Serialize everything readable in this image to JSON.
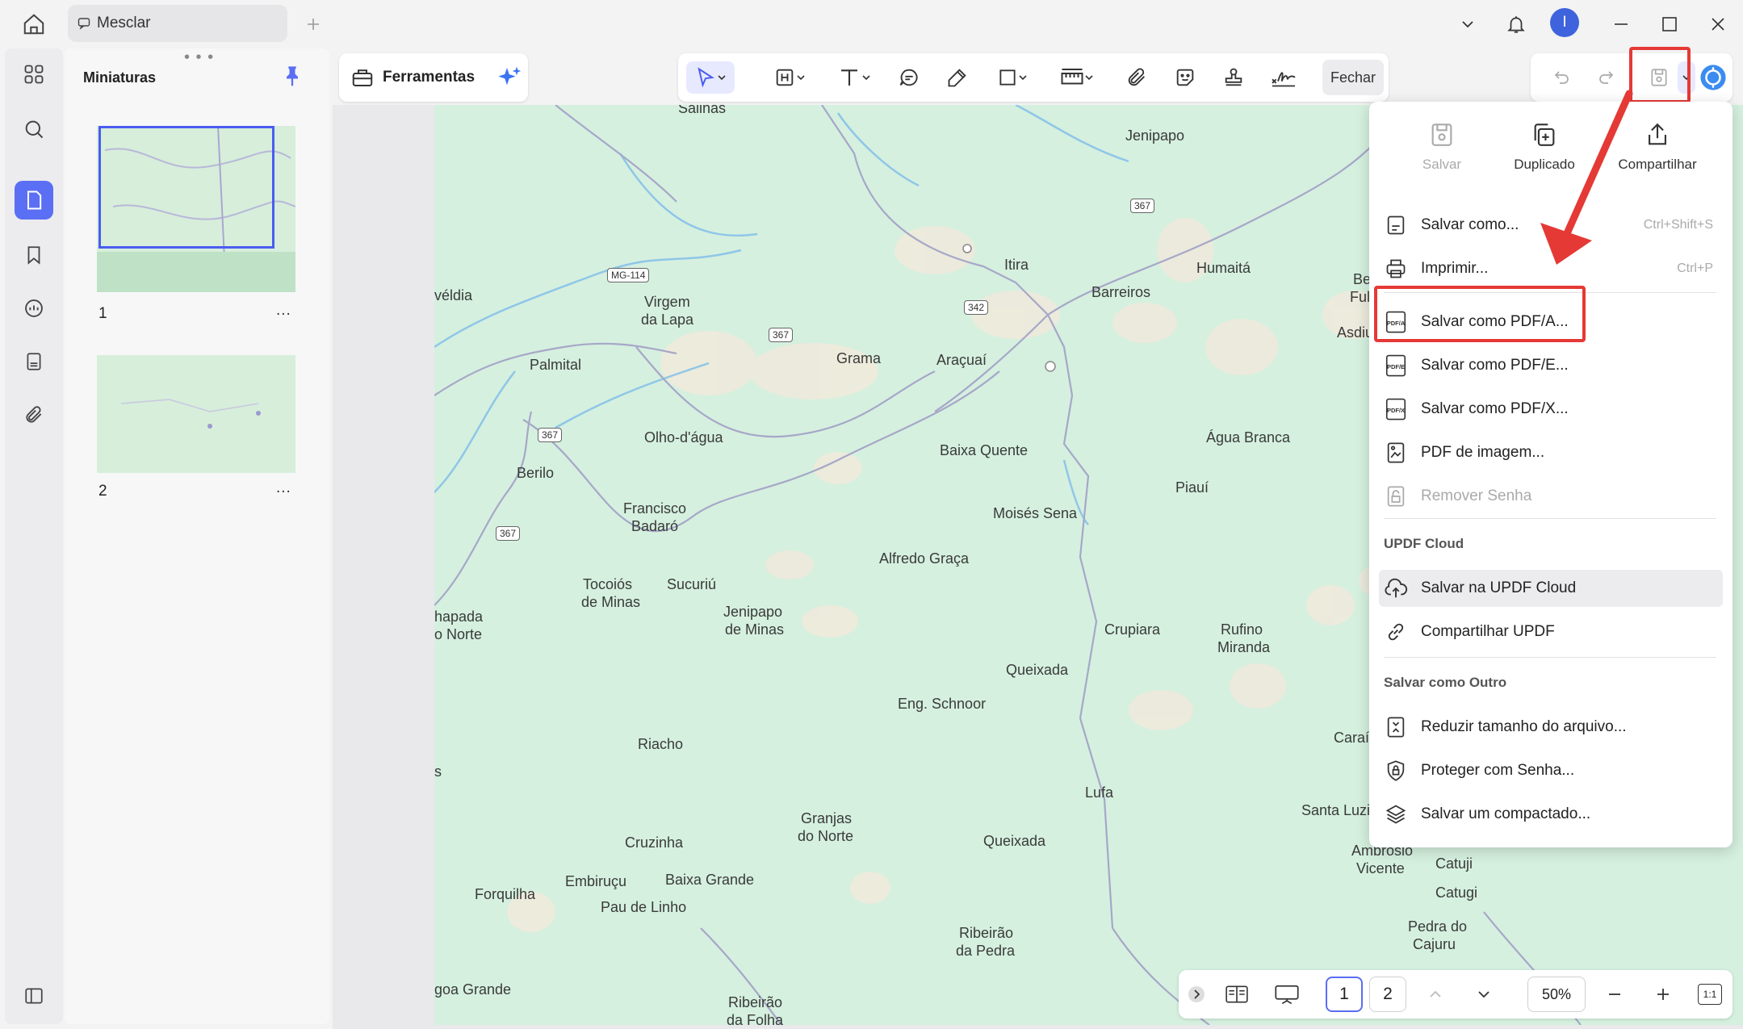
{
  "tab": {
    "title": "Mesclar"
  },
  "user": {
    "initial": "I"
  },
  "thumbnails": {
    "title": "Miniaturas",
    "pages": [
      {
        "number": "1",
        "more": "..."
      },
      {
        "number": "2",
        "more": "..."
      }
    ]
  },
  "toolbar": {
    "tools_label": "Ferramentas",
    "close_label": "Fechar"
  },
  "menu": {
    "quick": [
      {
        "label": "Salvar",
        "icon": "save-icon",
        "disabled": true
      },
      {
        "label": "Duplicado",
        "icon": "duplicate-icon",
        "disabled": false
      },
      {
        "label": "Compartilhar",
        "icon": "share-icon",
        "disabled": false
      }
    ],
    "items": [
      {
        "label": "Salvar como...",
        "shortcut": "Ctrl+Shift+S"
      },
      {
        "label": "Imprimir...",
        "shortcut": "Ctrl+P"
      },
      {
        "label": "Salvar como PDF/A..."
      },
      {
        "label": "Salvar como PDF/E..."
      },
      {
        "label": "Salvar como PDF/X..."
      },
      {
        "label": "PDF de imagem..."
      },
      {
        "label": "Remover Senha",
        "disabled": true
      }
    ],
    "cloud_section": "UPDF Cloud",
    "cloud_items": [
      {
        "label": "Salvar na UPDF Cloud"
      },
      {
        "label": "Compartilhar UPDF"
      }
    ],
    "other_section": "Salvar como Outro",
    "other_items": [
      {
        "label": "Reduzir tamanho do arquivo..."
      },
      {
        "label": "Proteger com Senha..."
      },
      {
        "label": "Salvar um compactado..."
      }
    ]
  },
  "bottom": {
    "page1": "1",
    "page2": "2",
    "zoom": "50%",
    "fit_label": "1:1"
  },
  "map": {
    "places": [
      "Salinas",
      "Jenipapo",
      "Itira",
      "Humaitá",
      "Barreiros",
      "Be",
      "Ful",
      "Asdiu",
      "véldia",
      "Virgem",
      "da Lapa",
      "Palmital",
      "Grama",
      "Araçuaí",
      "Olho-d'água",
      "Berilo",
      "Francisco",
      "Badaró",
      "Baixa Quente",
      "Água Branca",
      "Piauí",
      "Moisés Sena",
      "Alfredo Graça",
      "Tocoiós",
      "de Minas",
      "Sucuriú",
      "Jenipapo",
      "de Minas",
      "hapada",
      "o Norte",
      "Crupiara",
      "Rufino",
      "Miranda",
      "Queixada",
      "Eng. Schnoor",
      "Riacho",
      "Caraí",
      "s",
      "Lufa",
      "Santa Luzi",
      "Granjas",
      "do Norte",
      "Cruzinha",
      "Queixada",
      "Ambrósio",
      "Vicente",
      "Catuji",
      "Catugi",
      "Forquilha",
      "Embiruçu",
      "Baixa Grande",
      "Pau de Linho",
      "Pedra do",
      "Cajuru",
      "Ribeirão",
      "da Pedra",
      "goa Grande",
      "Ribeirão",
      "da Folha"
    ],
    "shields": [
      "MG-114",
      "367",
      "342",
      "367",
      "367",
      "367",
      "367"
    ]
  },
  "colors": {
    "accent": "#5b6ff5",
    "highlight": "#e53935",
    "map_bg": "#d5f0df"
  }
}
